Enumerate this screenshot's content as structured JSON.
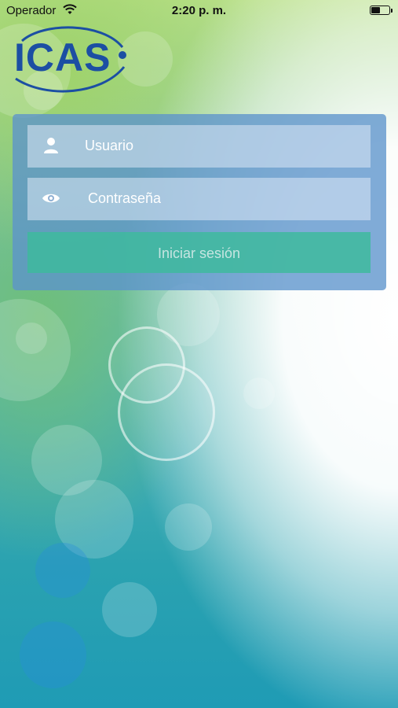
{
  "status_bar": {
    "carrier": "Operador",
    "time": "2:20 p. m.",
    "wifi_icon": "wifi-icon",
    "battery_icon": "battery-icon"
  },
  "logo": {
    "text": "ICAS"
  },
  "login": {
    "username_placeholder": "Usuario",
    "username_icon": "user-icon",
    "password_placeholder": "Contraseña",
    "password_icon": "eye-icon",
    "submit_label": "Iniciar sesión"
  },
  "colors": {
    "card": "#5c94cc",
    "button": "#3eba9e",
    "logo": "#1c4fa3"
  }
}
